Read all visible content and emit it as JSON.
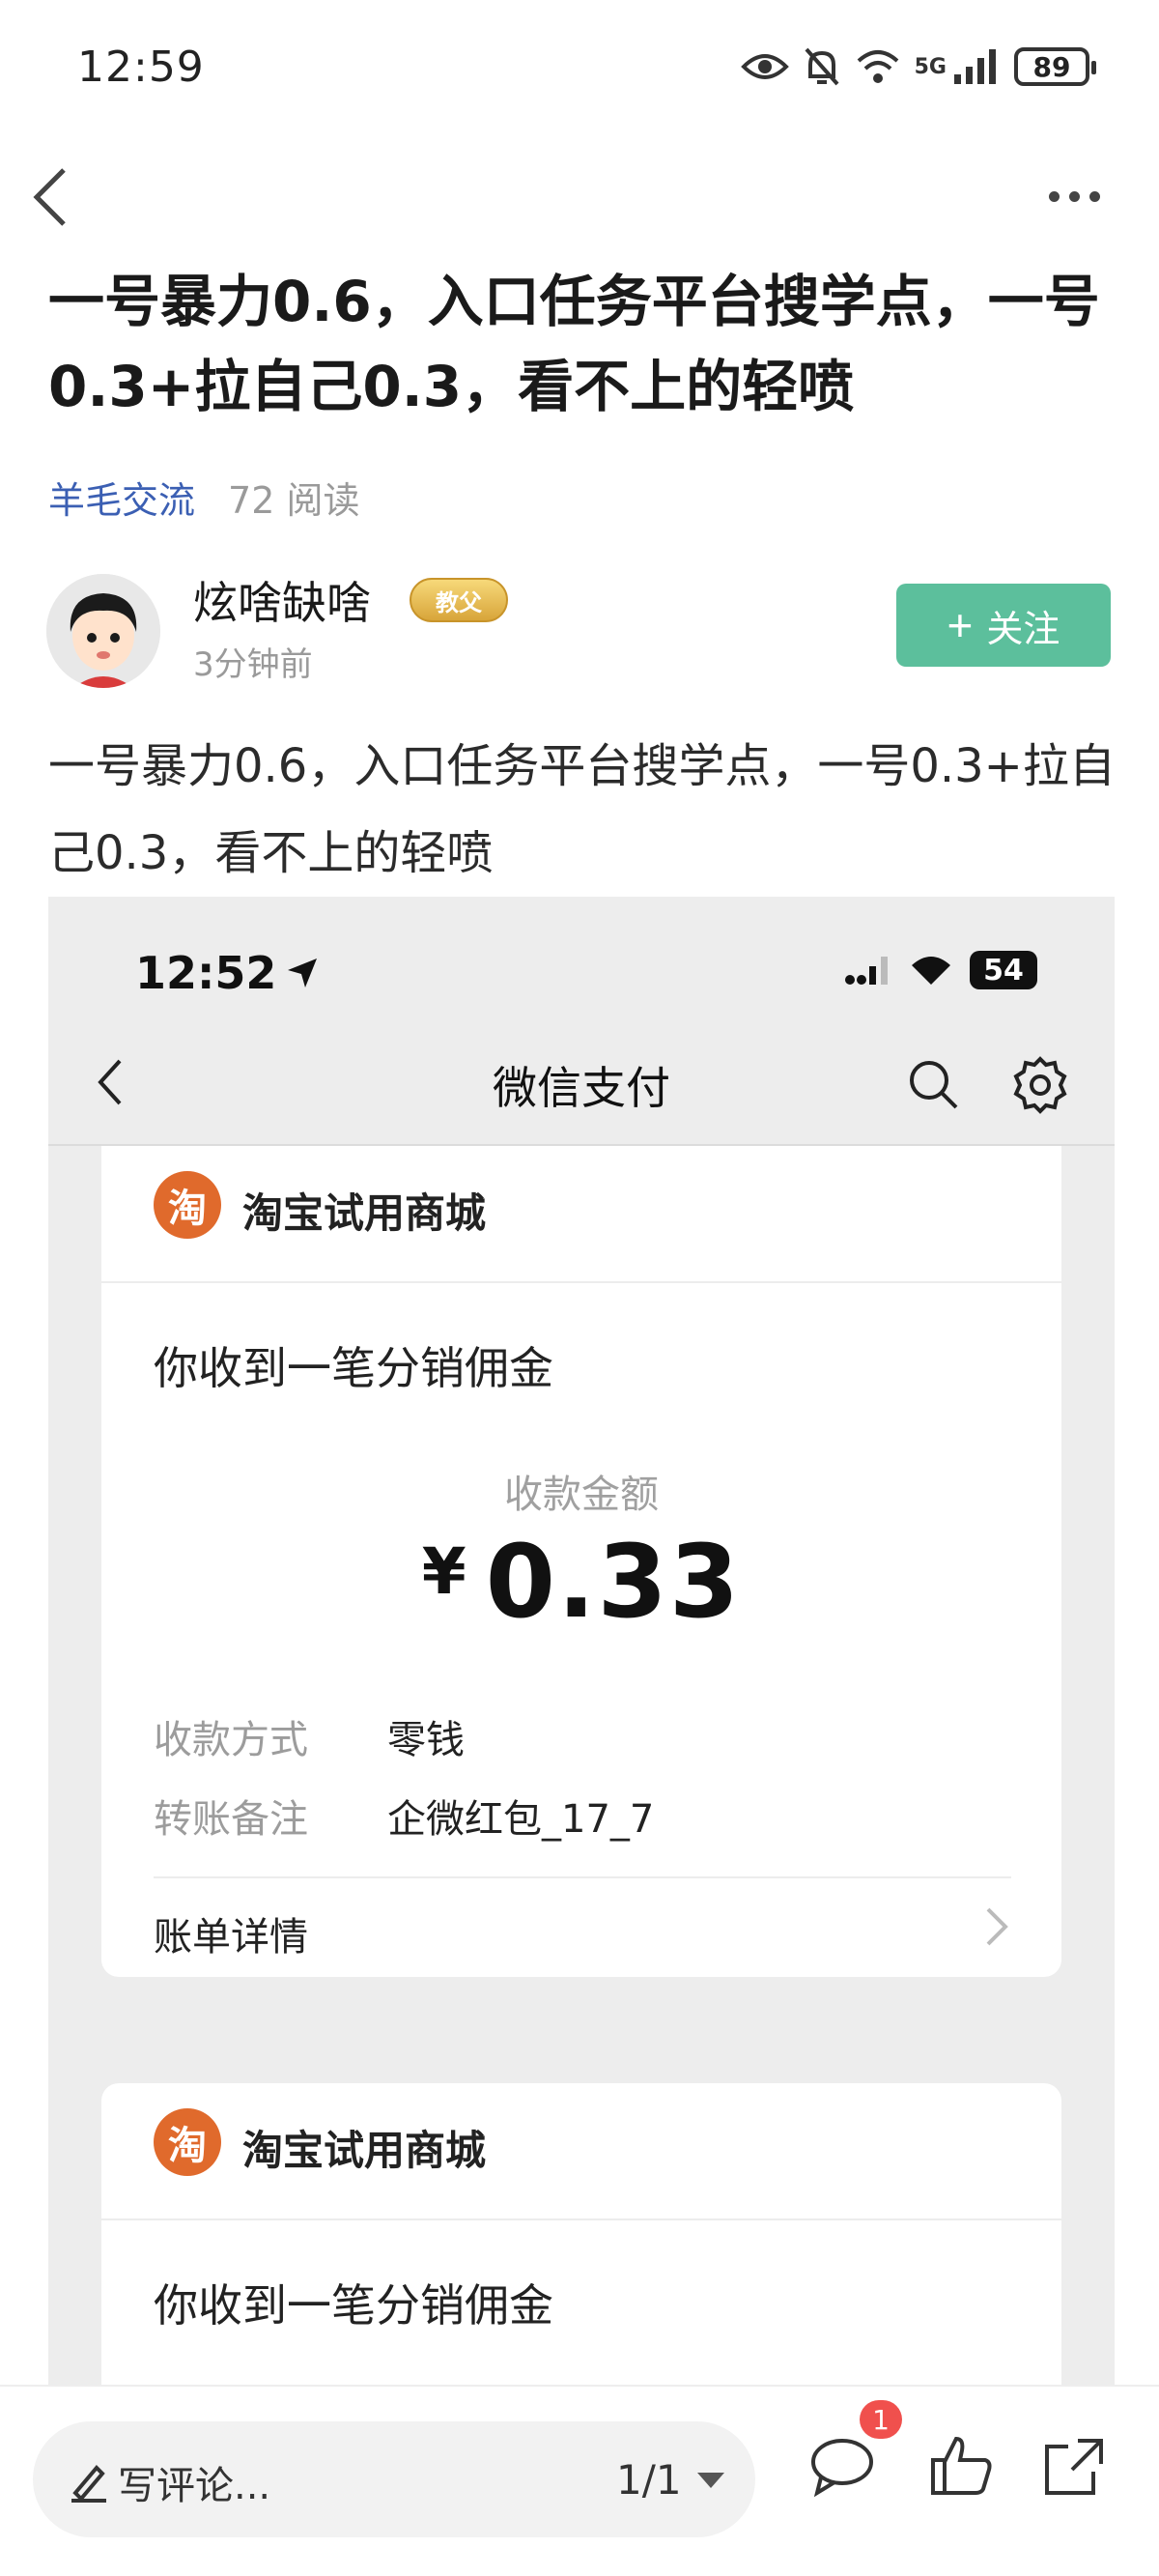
{
  "status_bar": {
    "time": "12:59",
    "network": "5G",
    "battery": "89"
  },
  "article": {
    "title": "一号暴力0.6，入口任务平台搜学点，一号0.3+拉自己0.3，看不上的轻喷",
    "category": "羊毛交流",
    "reads": "72 阅读",
    "author": {
      "name": "炫啥缺啥",
      "badge": "教父",
      "posted": "3分钟前"
    },
    "follow_label": "关注",
    "body": "一号暴力0.6，入口任务平台搜学点，一号0.3+拉自己0.3，看不上的轻喷"
  },
  "screenshot": {
    "status_time": "12:52",
    "battery": "54",
    "nav_title": "微信支付",
    "card1": {
      "merchant_logo": "淘",
      "merchant": "淘宝试用商城",
      "notice": "你收到一笔分销佣金",
      "amount_label": "收款金额",
      "currency": "¥",
      "amount": "0.33",
      "method_key": "收款方式",
      "method_val": "零钱",
      "remark_key": "转账备注",
      "remark_val": "企微红包_17_7",
      "detail_label": "账单详情"
    },
    "card2": {
      "merchant_logo": "淘",
      "merchant": "淘宝试用商城",
      "notice": "你收到一笔分销佣金"
    }
  },
  "bottom_bar": {
    "comment_placeholder": "写评论...",
    "pager": "1/1",
    "comment_count": "1"
  },
  "icons": [
    "eye-icon",
    "mute-icon",
    "wifi-icon",
    "signal-icon",
    "back-icon",
    "more-icon",
    "plus-icon",
    "location-arrow-icon",
    "search-icon",
    "gear-icon",
    "chevron-right-icon",
    "pen-icon",
    "comment-icon",
    "like-icon",
    "share-icon"
  ],
  "colors": {
    "follow": "#5cbf9c",
    "category": "#3b5fb3",
    "badge": "#f0504d",
    "merchant_logo": "#e06a2c"
  }
}
